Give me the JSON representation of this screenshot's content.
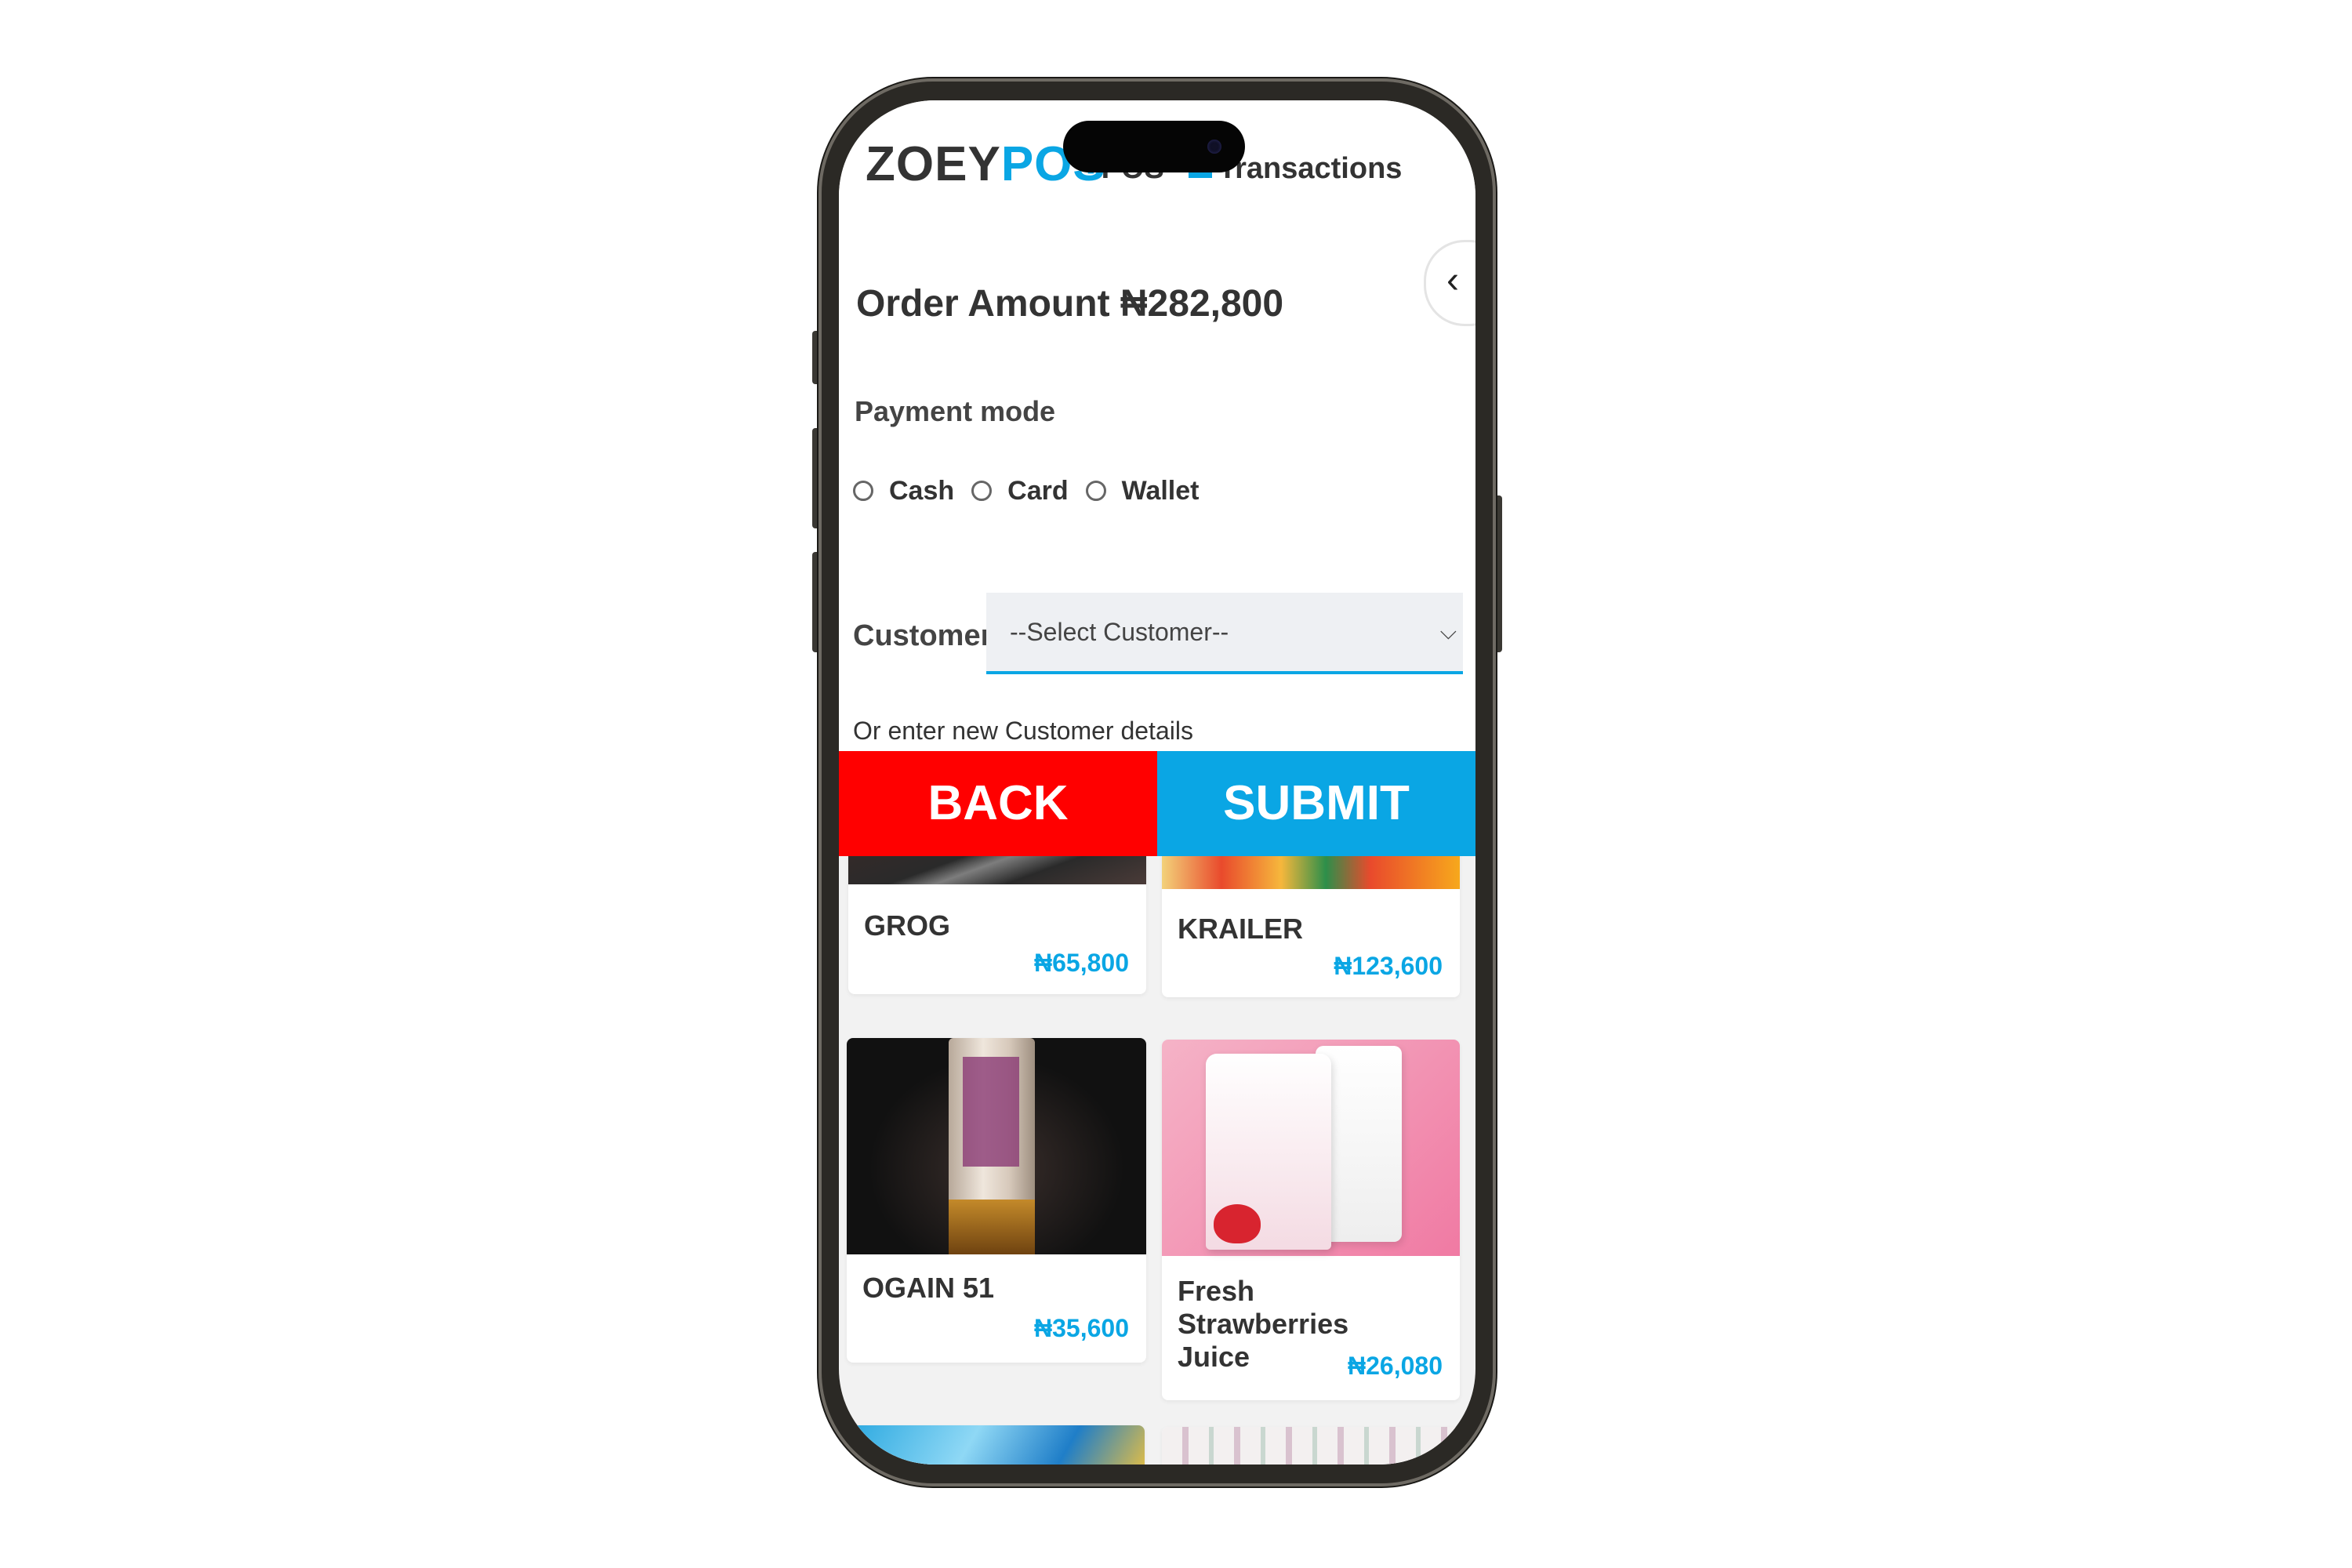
{
  "header": {
    "logo_part1": "ZOEY",
    "logo_part2": "POS",
    "nav_pos": "POS",
    "nav_transactions": "Transactions"
  },
  "order": {
    "amount_label": "Order Amount ₦282,800"
  },
  "payment": {
    "label": "Payment mode",
    "options": [
      "Cash",
      "Card",
      "Wallet"
    ]
  },
  "customer": {
    "label": "Customer",
    "select_value": "--Select Customer--",
    "new_customer_text": "Or enter new Customer details"
  },
  "actions": {
    "back_label": "BACK",
    "submit_label": "SUBMIT"
  },
  "products": [
    {
      "name": "GROG",
      "price": "₦65,800"
    },
    {
      "name": "KRAILER",
      "price": "₦123,600"
    },
    {
      "name": "OGAIN 51",
      "price": "₦35,600"
    },
    {
      "name": "Fresh Strawberries Juice",
      "price": "₦26,080"
    }
  ],
  "colors": {
    "accent": "#0aa6e4",
    "back_button": "#ff0000",
    "text_dark": "#333333"
  },
  "icons": {
    "collapse": "chevron-left-icon",
    "select": "chevron-down-icon"
  }
}
